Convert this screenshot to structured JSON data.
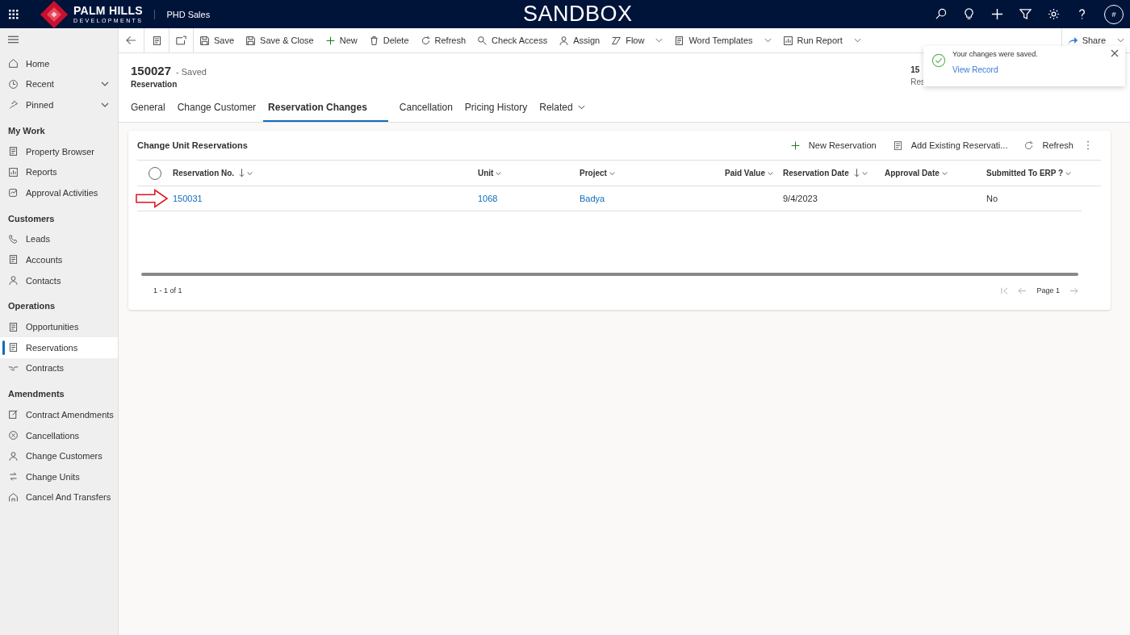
{
  "top_bar": {
    "brand_name": "PALM HILLS",
    "brand_sub": "DEVELOPMENTS",
    "app_name": "PHD Sales",
    "environment": "SANDBOX",
    "avatar": "#"
  },
  "nav": {
    "top": [
      {
        "label": "Home",
        "kind": "link"
      },
      {
        "label": "Recent",
        "kind": "menu"
      },
      {
        "label": "Pinned",
        "kind": "menu"
      }
    ],
    "groups": [
      {
        "heading": "My Work",
        "items": [
          {
            "label": "Property Browser",
            "selected": false
          },
          {
            "label": "Reports",
            "selected": false
          },
          {
            "label": "Approval Activities",
            "selected": false
          }
        ]
      },
      {
        "heading": "Customers",
        "items": [
          {
            "label": "Leads",
            "selected": false
          },
          {
            "label": "Accounts",
            "selected": false
          },
          {
            "label": "Contacts",
            "selected": false
          }
        ]
      },
      {
        "heading": "Operations",
        "items": [
          {
            "label": "Opportunities",
            "selected": false
          },
          {
            "label": "Reservations",
            "selected": true
          },
          {
            "label": "Contracts",
            "selected": false
          }
        ]
      },
      {
        "heading": "Amendments",
        "items": [
          {
            "label": "Contract Amendments",
            "selected": false
          },
          {
            "label": "Cancellations",
            "selected": false
          },
          {
            "label": "Change Customers",
            "selected": false
          },
          {
            "label": "Change Units",
            "selected": false
          },
          {
            "label": "Cancel And Transfers",
            "selected": false
          }
        ]
      }
    ]
  },
  "commands": [
    {
      "label": "Save",
      "dropdown": false
    },
    {
      "label": "Save & Close",
      "dropdown": false
    },
    {
      "label": "New",
      "dropdown": false
    },
    {
      "label": "Delete",
      "dropdown": false
    },
    {
      "label": "Refresh",
      "dropdown": false
    },
    {
      "label": "Check Access",
      "dropdown": false
    },
    {
      "label": "Assign",
      "dropdown": false
    },
    {
      "label": "Flow",
      "dropdown": true
    },
    {
      "label": "Word Templates",
      "dropdown": true
    },
    {
      "label": "Run Report",
      "dropdown": true
    }
  ],
  "share": {
    "label": "Share"
  },
  "record": {
    "title": "150027",
    "status": "- Saved",
    "entity": "Reservation",
    "header_field": {
      "value": "15",
      "label": "Res"
    }
  },
  "tabs": [
    {
      "label": "General",
      "selected": false,
      "dropdown": false
    },
    {
      "label": "Change Customer",
      "selected": false,
      "dropdown": false
    },
    {
      "label": "Reservation Changes",
      "selected": true,
      "dropdown": false
    },
    {
      "label": "Cancellation",
      "selected": false,
      "dropdown": false
    },
    {
      "label": "Pricing History",
      "selected": false,
      "dropdown": false
    },
    {
      "label": "Related",
      "selected": false,
      "dropdown": true
    }
  ],
  "subgrid": {
    "title": "Change Unit Reservations",
    "commands": [
      "New Reservation",
      "Add Existing Reservati...",
      "Refresh"
    ],
    "select_all": {
      "checked": false
    },
    "columns": [
      {
        "label": "Reservation No.",
        "sorted": true
      },
      {
        "label": "Unit",
        "sorted": false
      },
      {
        "label": "Project",
        "sorted": false
      },
      {
        "label": "Paid Value",
        "sorted": false
      },
      {
        "label": "Reservation Date",
        "sorted": true
      },
      {
        "label": "Approval Date",
        "sorted": false
      },
      {
        "label": "Submitted To ERP ?",
        "sorted": false
      }
    ],
    "rows": [
      {
        "selected": false,
        "marked": true,
        "cells": [
          {
            "kind": "link",
            "text": "150031"
          },
          {
            "kind": "link",
            "text": "1068"
          },
          {
            "kind": "link",
            "text": "Badya"
          },
          {
            "kind": "empty"
          },
          {
            "kind": "text",
            "text": "9/4/2023"
          },
          {
            "kind": "empty"
          },
          {
            "kind": "text",
            "text": "No"
          }
        ]
      }
    ],
    "count": "1 - 1 of 1",
    "page": "Page 1"
  },
  "toast": {
    "message": "Your changes were saved.",
    "link": "View Record"
  }
}
